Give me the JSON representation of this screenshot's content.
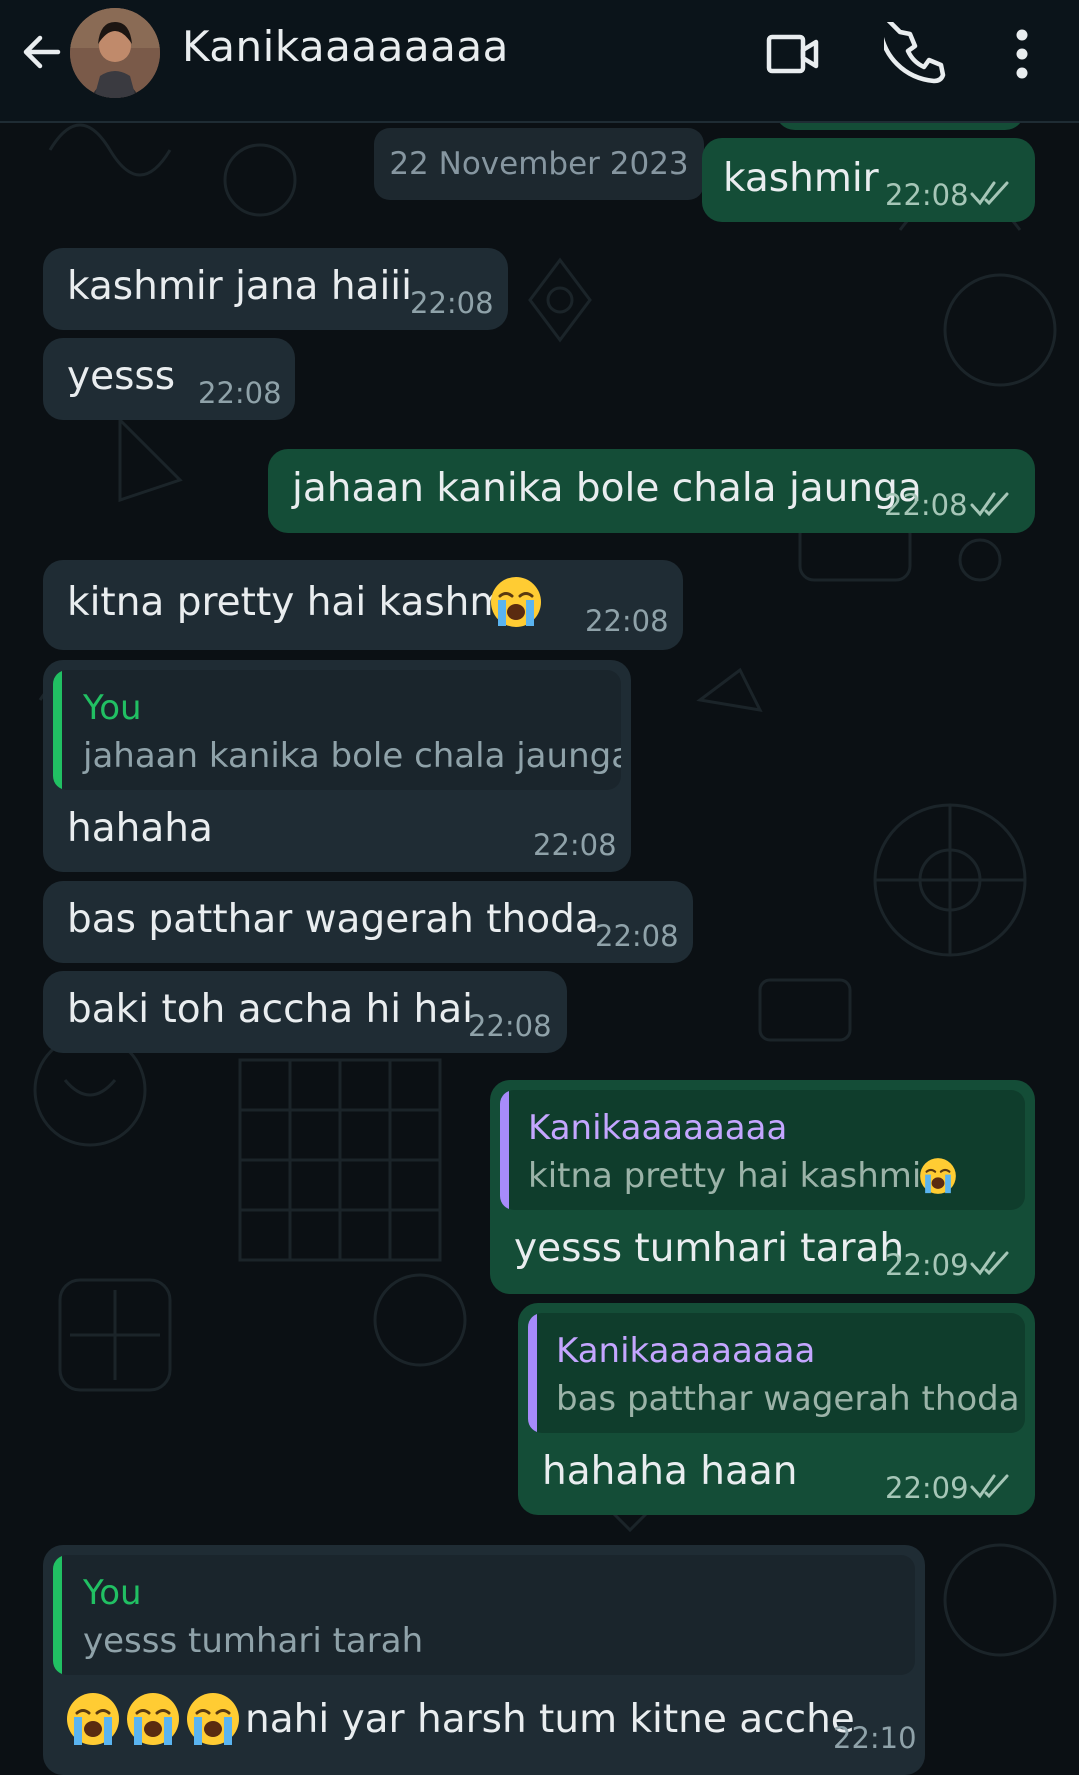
{
  "header": {
    "contact_name": "Kanikaaaaaaaa",
    "icons": [
      "back-arrow-icon",
      "avatar",
      "video-call-icon",
      "phone-icon",
      "more-options-icon"
    ]
  },
  "date_separator": "22 November 2023",
  "colors": {
    "incoming_bubble": "#1f2c34",
    "outgoing_bubble": "#144d37",
    "self_quote_bar": "#21c063",
    "contact_quote_bar": "#a78bfa",
    "contact_quote_name": "#c4a6ff",
    "self_quote_name": "#21c063",
    "read_ticks": "#a6c6b7"
  },
  "messages": [
    {
      "dir": "out",
      "text": "kashmir",
      "time": "22:08"
    },
    {
      "dir": "in",
      "text": "kashmir jana haiii",
      "time": "22:08"
    },
    {
      "dir": "in",
      "text": "yesss",
      "time": "22:08"
    },
    {
      "dir": "out",
      "text": "jahaan kanika bole chala jaunga",
      "time": "22:08"
    },
    {
      "dir": "in",
      "text": "kitna pretty hai kashmir",
      "emoji": "loudly-crying-face",
      "time": "22:08"
    },
    {
      "dir": "in",
      "quote_name": "You",
      "quote_text": "jahaan kanika bole chala jaunga",
      "text": "hahaha",
      "time": "22:08"
    },
    {
      "dir": "in",
      "text": "bas patthar wagerah thoda",
      "time": "22:08"
    },
    {
      "dir": "in",
      "text": "baki toh accha hi hai",
      "time": "22:08"
    },
    {
      "dir": "out",
      "quote_name": "Kanikaaaaaaaa",
      "quote_text": "kitna pretty hai kashmir",
      "text": "yesss tumhari tarah",
      "time": "22:09"
    },
    {
      "dir": "out",
      "quote_name": "Kanikaaaaaaaa",
      "quote_text": "bas patthar wagerah thoda",
      "text": "hahaha haan",
      "time": "22:09"
    },
    {
      "dir": "in",
      "quote_name": "You",
      "quote_text": "yesss tumhari tarah",
      "text": "nahi yar harsh tum kitne acche",
      "emoji_prefix_count": 3,
      "time": "22:10"
    }
  ]
}
